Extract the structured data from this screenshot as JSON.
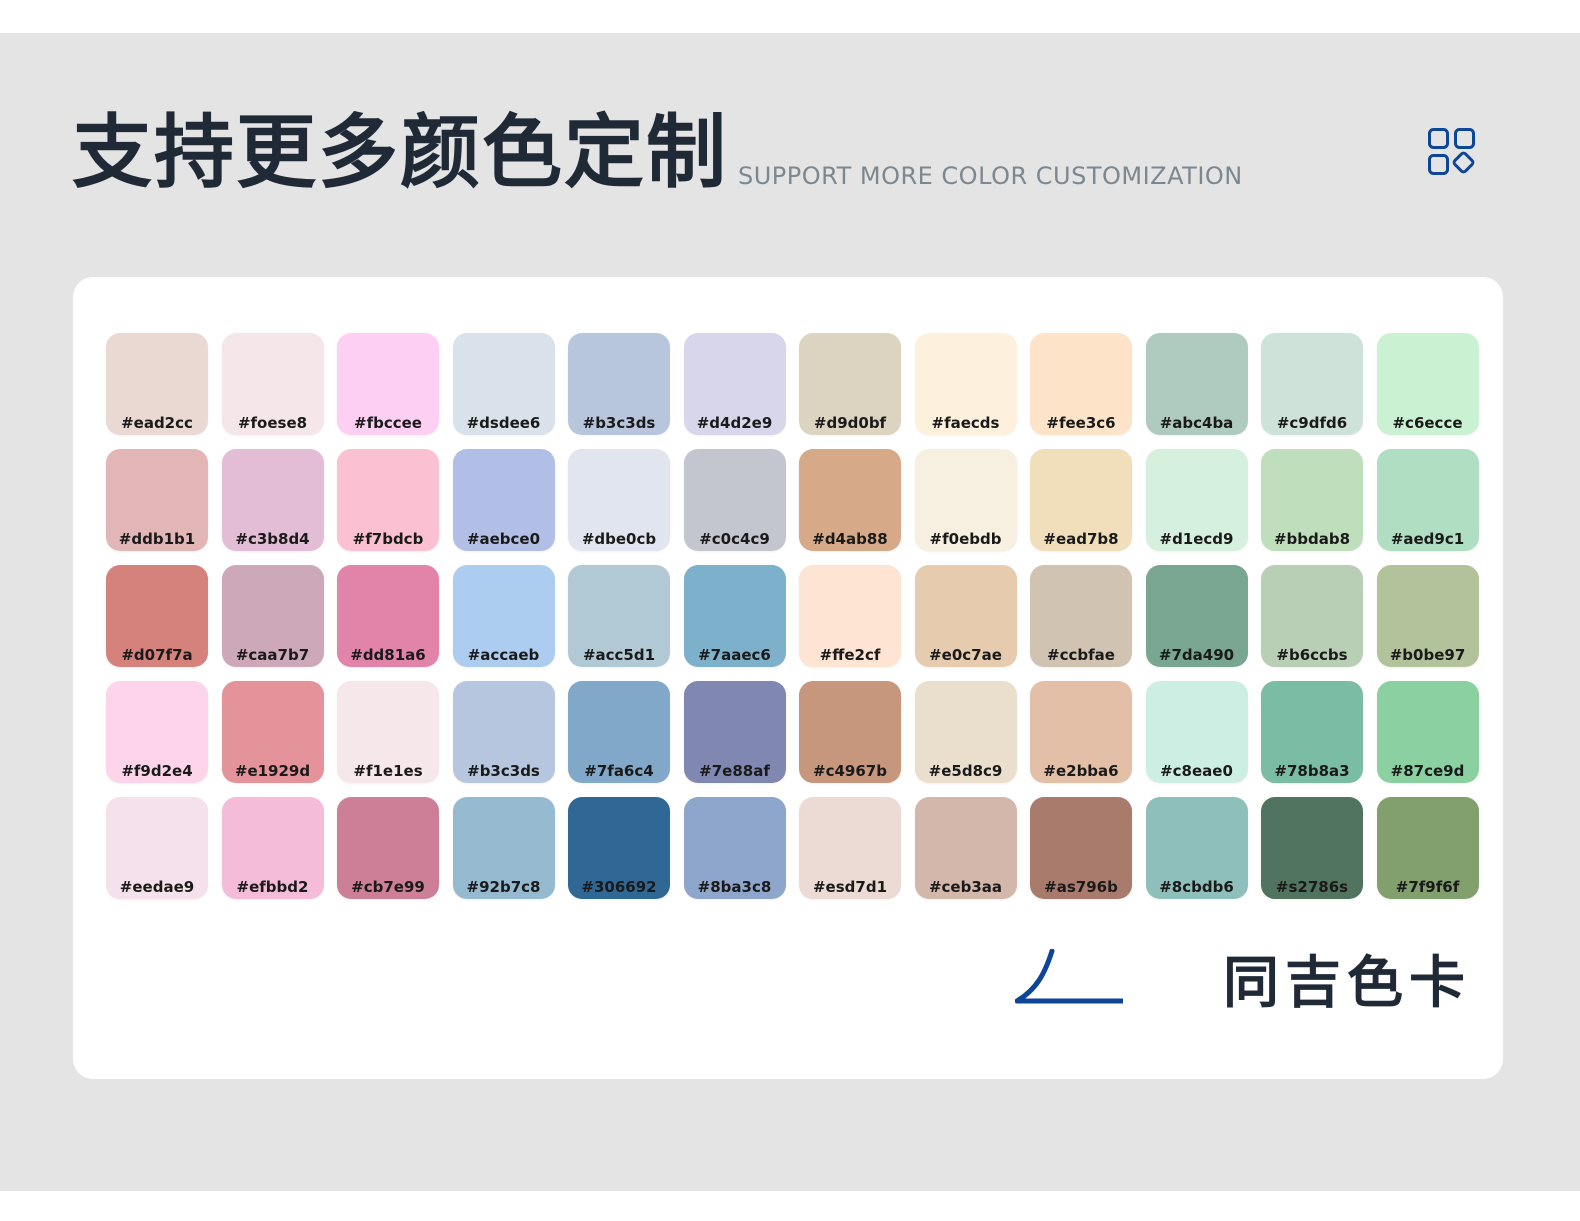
{
  "header": {
    "title": "支持更多颜色定制",
    "subtitle": "SUPPORT MORE COLOR CUSTOMIZATION",
    "icon": "grid-icon"
  },
  "colors": {
    "background": "#e4e4e4",
    "card": "#ffffff",
    "title": "#1f2a36",
    "subtitle": "#7d8790",
    "brand": "#0d4597"
  },
  "swatches": [
    {
      "label": "#ead2cc",
      "color": "#ead8d2"
    },
    {
      "label": "#foese8",
      "color": "#f5e6ea"
    },
    {
      "label": "#fbccee",
      "color": "#fdd0f3"
    },
    {
      "label": "#dsdee6",
      "color": "#d9e1ea"
    },
    {
      "label": "#b3c3ds",
      "color": "#b7c6dc"
    },
    {
      "label": "#d4d2e9",
      "color": "#d8d6eb"
    },
    {
      "label": "#d9d0bf",
      "color": "#dcd4c0"
    },
    {
      "label": "#faecds",
      "color": "#fdf0dc"
    },
    {
      "label": "#fee3c6",
      "color": "#fde4c9"
    },
    {
      "label": "#abc4ba",
      "color": "#afcabe"
    },
    {
      "label": "#c9dfd6",
      "color": "#cfe2da"
    },
    {
      "label": "#c6ecce",
      "color": "#caf1d2"
    },
    {
      "label": "#ddb1b1",
      "color": "#e2b6b6"
    },
    {
      "label": "#c3b8d4",
      "color": "#e3bcd6"
    },
    {
      "label": "#f7bdcb",
      "color": "#fbc0d2"
    },
    {
      "label": "#aebce0",
      "color": "#b1bee6"
    },
    {
      "label": "#dbe0cb",
      "color": "#e1e5f0"
    },
    {
      "label": "#c0c4c9",
      "color": "#c3c6cf"
    },
    {
      "label": "#d4ab88",
      "color": "#d6aa88"
    },
    {
      "label": "#f0ebdb",
      "color": "#f7efdf"
    },
    {
      "label": "#ead7b8",
      "color": "#f0dfba"
    },
    {
      "label": "#d1ecd9",
      "color": "#d5f0dd"
    },
    {
      "label": "#bbdab8",
      "color": "#bfdfbc"
    },
    {
      "label": "#aed9c1",
      "color": "#afdec3"
    },
    {
      "label": "#d07f7a",
      "color": "#d5827d"
    },
    {
      "label": "#caa7b7",
      "color": "#cca8b8"
    },
    {
      "label": "#dd81a6",
      "color": "#e284aa"
    },
    {
      "label": "#accaeb",
      "color": "#adcdf0"
    },
    {
      "label": "#acc5d1",
      "color": "#b1c9d4"
    },
    {
      "label": "#7aaec6",
      "color": "#7db0ca"
    },
    {
      "label": "#ffe2cf",
      "color": "#fde4d3"
    },
    {
      "label": "#e0c7ae",
      "color": "#e7cbaf"
    },
    {
      "label": "#ccbfae",
      "color": "#d0c3b1"
    },
    {
      "label": "#7da490",
      "color": "#78a690"
    },
    {
      "label": "#b6ccbs",
      "color": "#b8cfb6"
    },
    {
      "label": "#b0be97",
      "color": "#b2c29b"
    },
    {
      "label": "#f9d2e4",
      "color": "#fdd4e9"
    },
    {
      "label": "#e1929d",
      "color": "#e5939a"
    },
    {
      "label": "#f1e1es",
      "color": "#f6e7ea"
    },
    {
      "label": "#b3c3ds",
      "color": "#b6c6de"
    },
    {
      "label": "#7fa6c4",
      "color": "#82a8c9"
    },
    {
      "label": "#7e88af",
      "color": "#8088b2"
    },
    {
      "label": "#c4967b",
      "color": "#c7977d"
    },
    {
      "label": "#e5d8c9",
      "color": "#eadecd"
    },
    {
      "label": "#e2bba6",
      "color": "#e4bfa8"
    },
    {
      "label": "#c8eae0",
      "color": "#cdeee3"
    },
    {
      "label": "#78b8a3",
      "color": "#7bbca4"
    },
    {
      "label": "#87ce9d",
      "color": "#8ad0a0"
    },
    {
      "label": "#eedae9",
      "color": "#f5e1eb"
    },
    {
      "label": "#efbbd2",
      "color": "#f4bcd8"
    },
    {
      "label": "#cb7e99",
      "color": "#ce7f98"
    },
    {
      "label": "#92b7c8",
      "color": "#95bad0"
    },
    {
      "label": "#306692",
      "color": "#2f6894"
    },
    {
      "label": "#8ba3c8",
      "color": "#8ea5cc"
    },
    {
      "label": "#esd7d1",
      "color": "#ecdbd4"
    },
    {
      "label": "#ceb3aa",
      "color": "#d2b7aa"
    },
    {
      "label": "#as796b",
      "color": "#a87b6d"
    },
    {
      "label": "#8cbdb6",
      "color": "#8ebfba"
    },
    {
      "label": "#s2786s",
      "color": "#51745f"
    },
    {
      "label": "#7f9f6f",
      "color": "#81a06d"
    }
  ],
  "brand": {
    "name": "同吉色卡",
    "logo_icon": "brand-swoosh-icon"
  }
}
